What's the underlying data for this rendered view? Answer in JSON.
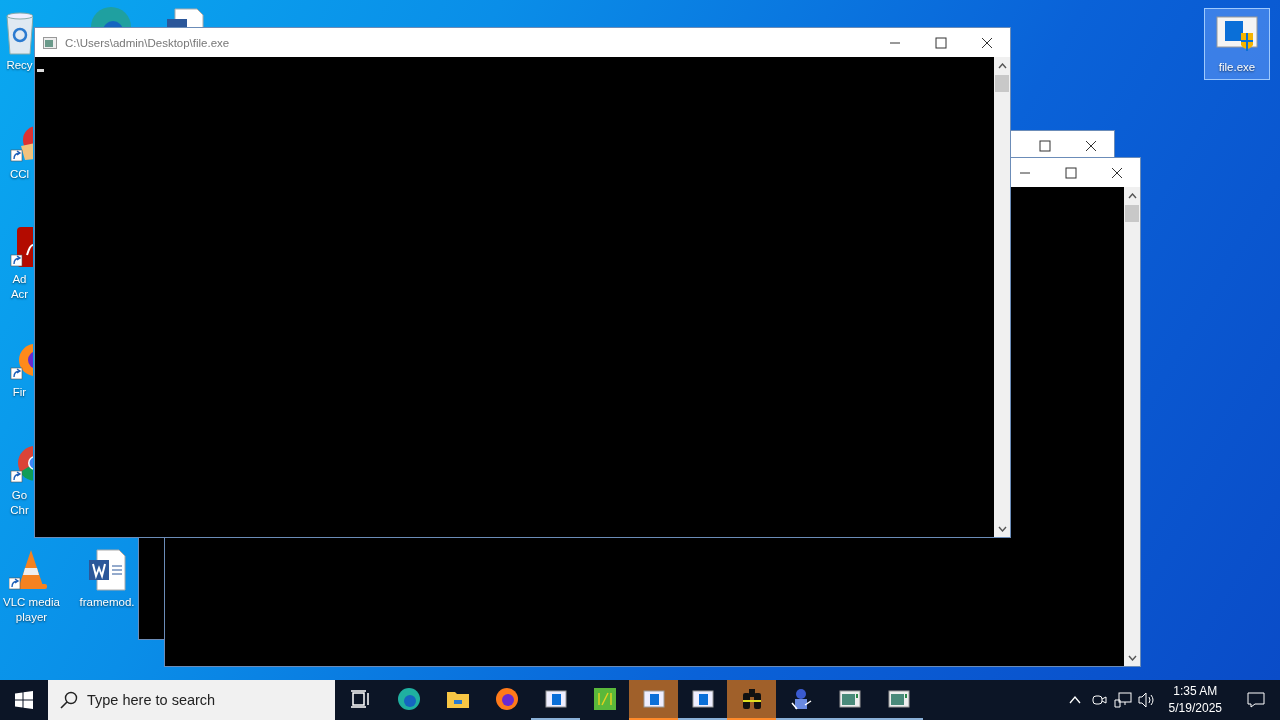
{
  "desktop_icons": [
    {
      "kind": "recycle",
      "lines": [
        "Recy"
      ],
      "selected": false
    },
    {
      "kind": "ccleaner",
      "lines": [
        "CCl"
      ],
      "selected": false
    },
    {
      "kind": "acrobat",
      "lines": [
        "Ad",
        "Acr"
      ],
      "selected": false
    },
    {
      "kind": "firefox",
      "lines": [
        "Fir"
      ],
      "selected": false
    },
    {
      "kind": "chrome",
      "lines": [
        "Go",
        "Chr"
      ],
      "selected": false
    },
    {
      "kind": "vlc",
      "lines": [
        "VLC media",
        "player"
      ],
      "selected": false
    },
    {
      "kind": "word",
      "lines": [
        "framemod."
      ],
      "selected": false
    },
    {
      "kind": "edge",
      "selected": false
    },
    {
      "kind": "worddoc",
      "selected": false
    },
    {
      "kind": "exe",
      "lines": [
        "file.exe"
      ],
      "selected": true
    }
  ],
  "console_windows": [
    {
      "kind": "console"
    },
    {
      "kind": "console"
    },
    {
      "title": "C:\\Users\\admin\\Desktop\\file.exe"
    }
  ],
  "taskbar": {
    "search": {
      "placeholder": "Type here to search"
    },
    "items": [
      {
        "kind": "taskview",
        "running": false,
        "active": false
      },
      {
        "kind": "edge",
        "running": false,
        "active": false
      },
      {
        "kind": "explorer",
        "running": false,
        "active": false
      },
      {
        "kind": "firefox",
        "running": false,
        "active": false
      },
      {
        "kind": "window",
        "running": true,
        "active": false
      },
      {
        "kind": "bh",
        "running": false,
        "active": false
      },
      {
        "kind": "window",
        "running": false,
        "active": true
      },
      {
        "kind": "window",
        "running": true,
        "active": false
      },
      {
        "kind": "binoculars",
        "running": false,
        "active": true
      },
      {
        "kind": "wizard",
        "running": true,
        "active": false
      },
      {
        "kind": "console",
        "running": true,
        "active": false
      },
      {
        "kind": "console",
        "running": true,
        "active": false
      }
    ],
    "time": "1:35 AM",
    "date": "5/19/2025"
  }
}
